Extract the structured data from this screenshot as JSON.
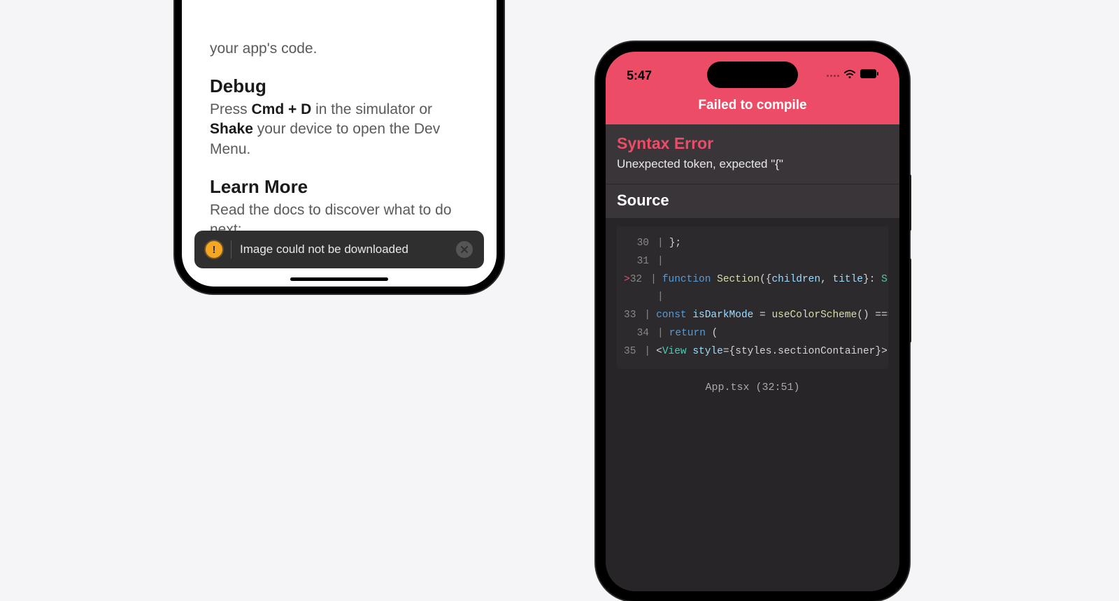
{
  "left": {
    "fragment": "your app's code.",
    "debug": {
      "heading": "Debug",
      "text_parts": [
        "Press ",
        "Cmd + D",
        " in the simulator or ",
        "Shake",
        " your device to open the Dev Menu."
      ]
    },
    "learn": {
      "heading": "Learn More",
      "text": "Read the docs to discover what to do next:"
    },
    "toast": {
      "message": "Image could not be downloaded"
    }
  },
  "right": {
    "status_time": "5:47",
    "error_header": "Failed to compile",
    "error_type": "Syntax Error",
    "error_message": "Unexpected token, expected \"{\"",
    "source_label": "Source",
    "code": {
      "lines": [
        {
          "marker": "",
          "num": "30",
          "content": "};"
        },
        {
          "marker": "",
          "num": "31",
          "content": ""
        },
        {
          "marker": ">",
          "num": "32",
          "content": "function Section({children, title}: Sectio"
        },
        {
          "marker": "",
          "num": "",
          "content": ""
        },
        {
          "marker": "",
          "num": "33",
          "content": "  const isDarkMode = useColorScheme() ==="
        },
        {
          "marker": "",
          "num": "34",
          "content": "  return ("
        },
        {
          "marker": "",
          "num": "35",
          "content": "    <View style={styles.sectionContainer}>"
        }
      ]
    },
    "file_location": "App.tsx (32:51)"
  }
}
